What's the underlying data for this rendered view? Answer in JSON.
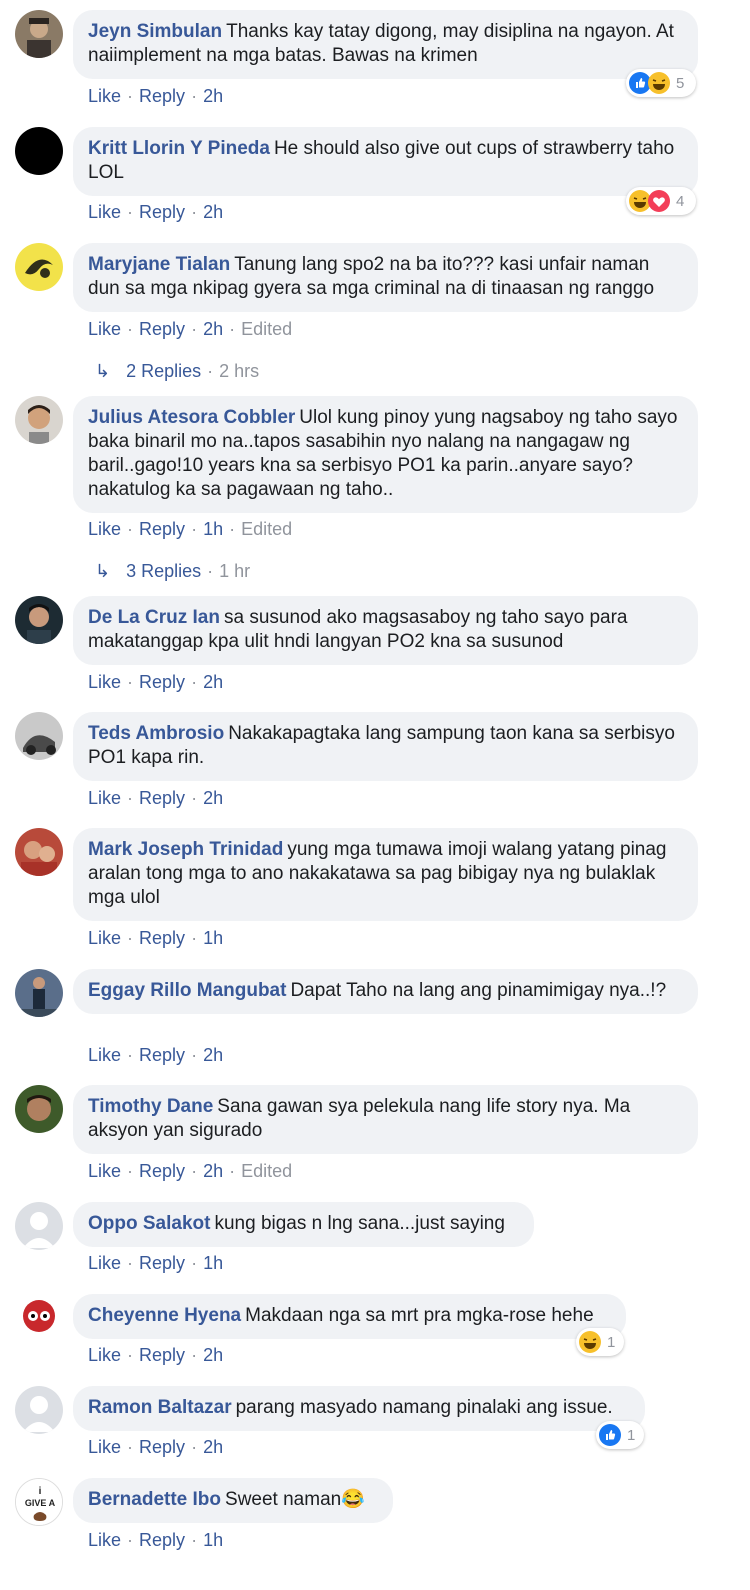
{
  "comments": [
    {
      "author": "Jeyn Simbulan",
      "text": "Thanks kay tatay digong, may disiplina na ngayon. At naiimplement na mga batas. Bawas na krimen",
      "time": "2h",
      "edited": "",
      "reactions": {
        "icons": [
          "like",
          "haha"
        ],
        "count": "5"
      }
    },
    {
      "author": "Kritt Llorin Y Pineda",
      "text": "He should also give out cups of strawberry taho LOL",
      "time": "2h",
      "edited": "",
      "reactions": {
        "icons": [
          "haha",
          "love"
        ],
        "count": "4"
      }
    },
    {
      "author": "Maryjane Tialan",
      "text": "Tanung lang spo2 na ba ito??? kasi unfair naman dun sa mga nkipag gyera sa mga criminal na di tinaasan ng ranggo",
      "time": "2h",
      "edited": "Edited",
      "replies": {
        "label": "2 Replies",
        "time": "2 hrs"
      }
    },
    {
      "author": "Julius Atesora Cobbler",
      "text": "Ulol kung pinoy yung nagsaboy ng taho sayo baka binaril mo na..tapos sasabihin nyo nalang na nangagaw ng baril..gago!10 years kna sa serbisyo PO1 ka parin..anyare sayo? nakatulog ka sa pagawaan ng taho..",
      "time": "1h",
      "edited": "Edited",
      "replies": {
        "label": "3 Replies",
        "time": "1 hr"
      }
    },
    {
      "author": "De La Cruz Ian",
      "text": "sa susunod ako magsasaboy ng taho sayo para makatanggap kpa ulit hndi langyan PO2 kna sa susunod",
      "time": "2h",
      "edited": ""
    },
    {
      "author": "Teds Ambrosio",
      "text": "Nakakapagtaka lang sampung taon kana sa serbisyo PO1 kapa rin.",
      "time": "2h",
      "edited": ""
    },
    {
      "author": "Mark Joseph Trinidad",
      "text": "yung mga tumawa imoji walang yatang pinag aralan tong mga to ano nakakatawa sa pag bibigay nya ng bulaklak mga ulol",
      "time": "1h",
      "edited": ""
    },
    {
      "author": "Eggay Rillo Mangubat",
      "text": "Dapat Taho na lang ang pinamimigay nya..!?",
      "time": "2h",
      "edited": ""
    },
    {
      "author": "Timothy Dane",
      "text": "Sana gawan sya pelekula nang life story nya. Ma aksyon yan sigurado",
      "time": "2h",
      "edited": "Edited"
    },
    {
      "author": "Oppo Salakot",
      "text": "kung bigas n lng sana...just saying",
      "time": "1h",
      "edited": ""
    },
    {
      "author": "Cheyenne Hyena",
      "text": "Makdaan nga sa mrt pra mgka-rose hehe",
      "time": "2h",
      "edited": "",
      "reactions": {
        "icons": [
          "haha"
        ],
        "count": "1"
      }
    },
    {
      "author": "Ramon Baltazar",
      "text": "parang masyado namang pinalaki ang issue.",
      "time": "2h",
      "edited": "",
      "reactions": {
        "icons": [
          "like"
        ],
        "count": "1"
      }
    },
    {
      "author": "Bernadette Ibo",
      "text": "Sweet naman😂",
      "time": "1h",
      "edited": ""
    }
  ],
  "labels": {
    "like": "Like",
    "reply": "Reply",
    "dot": "·"
  },
  "avatar_badge_text": "GIVE A",
  "colors": {
    "link": "#385898",
    "meta": "#90949c",
    "bubble": "#f0f2f5",
    "like": "#1877f2",
    "haha": "#f7c02b",
    "love": "#f33e58"
  }
}
